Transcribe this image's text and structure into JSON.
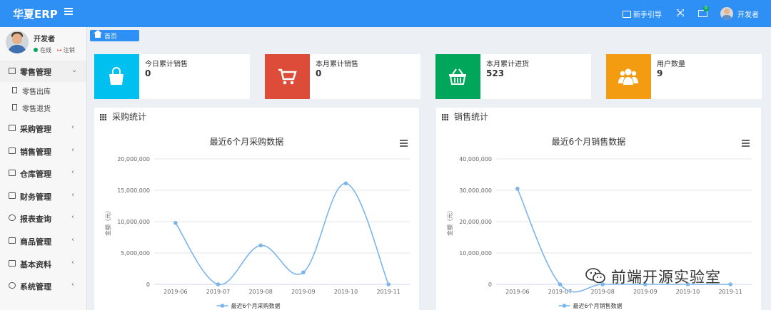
{
  "header": {
    "brand": "华夏ERP",
    "guide_label": "新手引导",
    "mail_badge": "0",
    "user": "开发者"
  },
  "sidebar": {
    "user_name": "开发者",
    "status_online": "在线",
    "status_logout": "注销",
    "menus": [
      {
        "label": "零售管理",
        "open": true,
        "children": [
          "零售出库",
          "零售退货"
        ]
      },
      {
        "label": "采购管理"
      },
      {
        "label": "销售管理"
      },
      {
        "label": "仓库管理"
      },
      {
        "label": "财务管理"
      },
      {
        "label": "报表查询"
      },
      {
        "label": "商品管理"
      },
      {
        "label": "基本资料"
      },
      {
        "label": "系统管理"
      }
    ]
  },
  "breadcrumb": {
    "label": "首页"
  },
  "stats": [
    {
      "label": "今日累计销售",
      "value": "0",
      "color": "#00c0ef",
      "icon": "shopping-bag-icon"
    },
    {
      "label": "本月累计销售",
      "value": "0",
      "color": "#dd4b39",
      "icon": "shopping-cart-icon"
    },
    {
      "label": "本月累计进货",
      "value": "523",
      "color": "#00a65a",
      "icon": "shopping-basket-icon"
    },
    {
      "label": "用户数量",
      "value": "9",
      "color": "#f39c12",
      "icon": "users-icon"
    }
  ],
  "panels": {
    "purchase": {
      "title": "采购统计"
    },
    "sales": {
      "title": "销售统计"
    }
  },
  "chart_data": [
    {
      "type": "line",
      "title": "最近6个月采购数据",
      "ylabel": "金额（元）",
      "categories": [
        "2019-06",
        "2019-07",
        "2019-08",
        "2019-09",
        "2019-10",
        "2019-11"
      ],
      "series": [
        {
          "name": "最近6个月采购数据",
          "values": [
            9800000,
            0,
            6200000,
            1900000,
            16100000,
            0
          ]
        }
      ],
      "ylim": [
        0,
        20000000
      ],
      "yticks": [
        "0",
        "5,000,000",
        "10,000,000",
        "15,000,000",
        "20,000,000"
      ],
      "smooth": true,
      "color": "#7cb5ec"
    },
    {
      "type": "line",
      "title": "最近6个月销售数据",
      "ylabel": "金额（元）",
      "categories": [
        "2019-06",
        "2019-07",
        "2019-08",
        "2019-09",
        "2019-10",
        "2019-11"
      ],
      "series": [
        {
          "name": "最近6个月销售数据",
          "values": [
            30500000,
            0,
            0,
            0,
            0,
            0
          ]
        }
      ],
      "ylim": [
        0,
        40000000
      ],
      "yticks": [
        "0",
        "10,000,000",
        "20,000,000",
        "30,000,000",
        "40,000,000"
      ],
      "smooth": true,
      "color": "#7cb5ec"
    }
  ],
  "watermark": {
    "text": "前端开源实验室"
  }
}
